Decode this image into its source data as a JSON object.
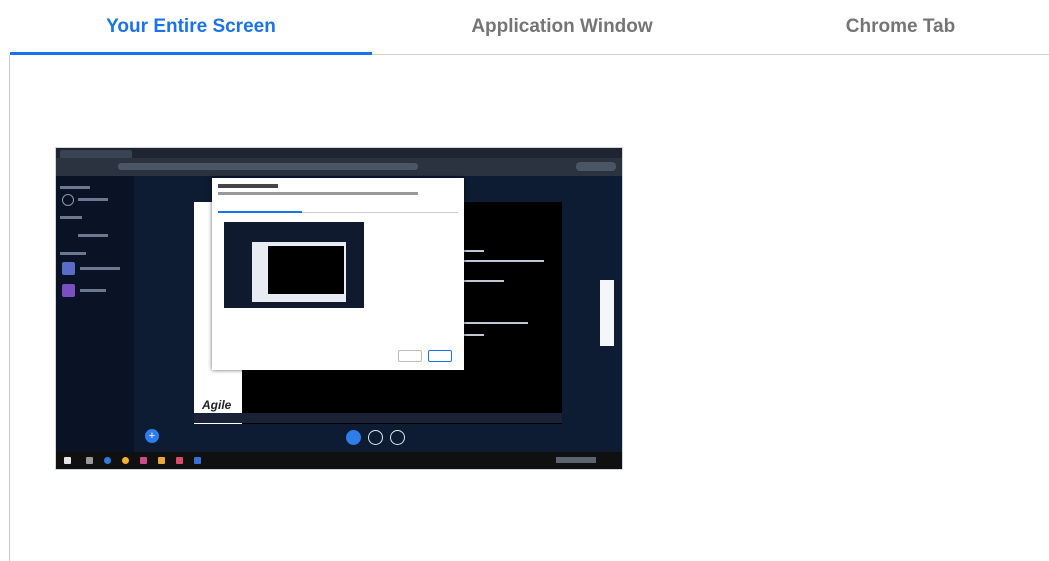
{
  "tabs": [
    {
      "label": "Your Entire Screen",
      "active": true
    },
    {
      "label": "Application Window",
      "active": false
    },
    {
      "label": "Chrome Tab",
      "active": false
    }
  ],
  "preview": {
    "slide_logo_text": "Agile"
  },
  "colors": {
    "accent": "#1a73e8",
    "tab_inactive": "#757575",
    "thumbnail_background": "#0d1b33"
  }
}
